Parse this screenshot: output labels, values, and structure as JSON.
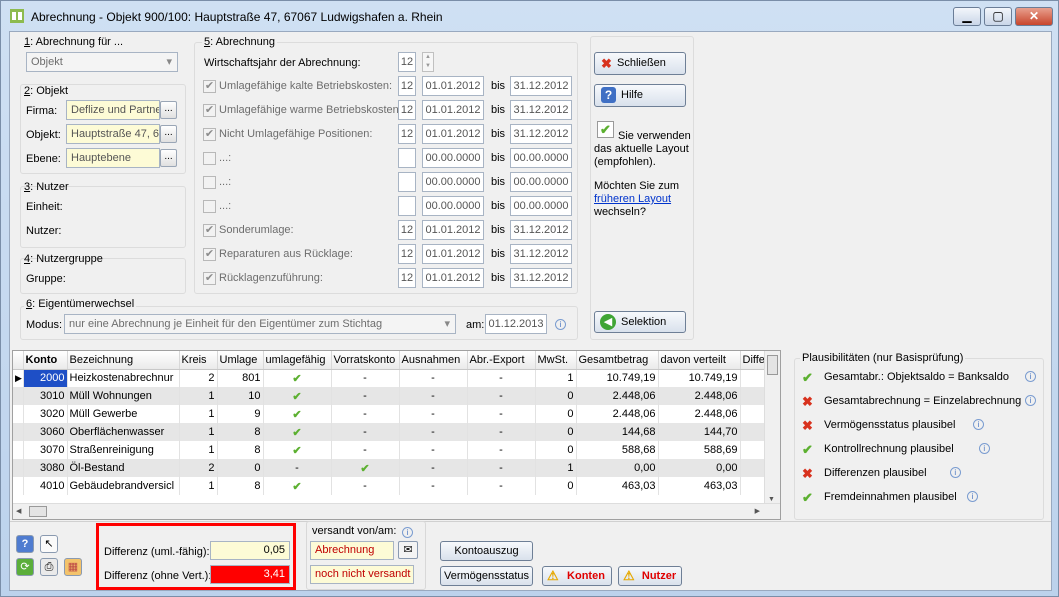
{
  "window": {
    "title": "Abrechnung - Objekt 900/100:  Hauptstraße 47, 67067 Ludwigshafen a. Rhein",
    "min": "▁",
    "max": "▢",
    "close": "✕"
  },
  "abr_fuer": {
    "label_num": "1",
    "label": ": Abrechnung für ...",
    "value": "Objekt"
  },
  "objekt": {
    "label_num": "2",
    "label": ": Objekt",
    "firma_label": "Firma:",
    "firma": "Deflize und Partne",
    "objekt_label": "Objekt:",
    "objekt": "Hauptstraße 47, 6",
    "ebene_label": "Ebene:",
    "ebene": "Hauptebene",
    "dots": "..."
  },
  "nutzer": {
    "label_num": "3",
    "label": ": Nutzer",
    "einheit": "Einheit:",
    "nutzer": "Nutzer:"
  },
  "gruppe": {
    "label_num": "4",
    "label": ": Nutzergruppe",
    "gruppe": "Gruppe:"
  },
  "abrechnung": {
    "label_num": "5",
    "label": ": Abrechnung",
    "wj_label": "Wirtschaftsjahr der Abrechnung:",
    "wj": "12",
    "bis": "bis",
    "rows": [
      {
        "label": "Umlagefähige kalte Betriebskosten:",
        "checked": true,
        "month": "12",
        "from": "01.01.2012",
        "to": "31.12.2012"
      },
      {
        "label": "Umlagefähige warme Betriebskosten:",
        "checked": true,
        "month": "12",
        "from": "01.01.2012",
        "to": "31.12.2012"
      },
      {
        "label": "Nicht Umlagefähige Positionen:",
        "checked": true,
        "month": "12",
        "from": "01.01.2012",
        "to": "31.12.2012"
      },
      {
        "label": "...:",
        "checked": false,
        "month": "",
        "from": "00.00.0000",
        "to": "00.00.0000"
      },
      {
        "label": "...:",
        "checked": false,
        "month": "",
        "from": "00.00.0000",
        "to": "00.00.0000"
      },
      {
        "label": "...:",
        "checked": false,
        "month": "",
        "from": "00.00.0000",
        "to": "00.00.0000"
      },
      {
        "label": "Sonderumlage:",
        "checked": true,
        "month": "12",
        "from": "01.01.2012",
        "to": "31.12.2012"
      },
      {
        "label": "Reparaturen aus Rücklage:",
        "checked": true,
        "month": "12",
        "from": "01.01.2012",
        "to": "31.12.2012"
      },
      {
        "label": "Rücklagenzuführung:",
        "checked": true,
        "month": "12",
        "from": "01.01.2012",
        "to": "31.12.2012"
      }
    ]
  },
  "eigentuemer": {
    "label_num": "6",
    "label": ": Eigentümerwechsel",
    "modus_label": "Modus:",
    "modus": "nur eine Abrechnung je Einheit für den Eigentümer zum Stichtag",
    "am_label": "am:",
    "am": "01.12.2013"
  },
  "right": {
    "close": "Schließen",
    "help": "Hilfe",
    "layout_text": "Sie verwenden das aktuelle Layout (empfohlen).",
    "switch_q": "Möchten Sie zum",
    "switch_link": "früheren Layout",
    "switch_tail": "wechseln?",
    "selektion": "Selektion"
  },
  "grid": {
    "columns": [
      "Konto",
      "Bezeichnung",
      "Kreis",
      "Umlage",
      "umlagefähig",
      "Vorratskonto",
      "Ausnahmen",
      "Abr.-Export",
      "MwSt.",
      "Gesamtbetrag",
      "davon verteilt",
      "Differe"
    ],
    "rows": [
      {
        "konto": "2000",
        "bez": "Heizkostenabrechnur",
        "kreis": "2",
        "umlage": "801",
        "uml": "check",
        "vorrat": "-",
        "ausn": "-",
        "export": "-",
        "mwst": "1",
        "gesamt": "10.749,19",
        "verteilt": "10.749,19"
      },
      {
        "konto": "3010",
        "bez": "Müll Wohnungen",
        "kreis": "1",
        "umlage": "10",
        "uml": "check",
        "vorrat": "-",
        "ausn": "-",
        "export": "-",
        "mwst": "0",
        "gesamt": "2.448,06",
        "verteilt": "2.448,06"
      },
      {
        "konto": "3020",
        "bez": "Müll Gewerbe",
        "kreis": "1",
        "umlage": "9",
        "uml": "check",
        "vorrat": "-",
        "ausn": "-",
        "export": "-",
        "mwst": "0",
        "gesamt": "2.448,06",
        "verteilt": "2.448,06"
      },
      {
        "konto": "3060",
        "bez": "Oberflächenwasser",
        "kreis": "1",
        "umlage": "8",
        "uml": "check",
        "vorrat": "-",
        "ausn": "-",
        "export": "-",
        "mwst": "0",
        "gesamt": "144,68",
        "verteilt": "144,70"
      },
      {
        "konto": "3070",
        "bez": "Straßenreinigung",
        "kreis": "1",
        "umlage": "8",
        "uml": "check",
        "vorrat": "-",
        "ausn": "-",
        "export": "-",
        "mwst": "0",
        "gesamt": "588,68",
        "verteilt": "588,69"
      },
      {
        "konto": "3080",
        "bez": "Öl-Bestand",
        "kreis": "2",
        "umlage": "0",
        "uml": "-",
        "vorrat": "check",
        "ausn": "-",
        "export": "-",
        "mwst": "1",
        "gesamt": "0,00",
        "verteilt": "0,00"
      },
      {
        "konto": "4010",
        "bez": "Gebäudebrandversicl",
        "kreis": "1",
        "umlage": "8",
        "uml": "check",
        "vorrat": "-",
        "ausn": "-",
        "export": "-",
        "mwst": "0",
        "gesamt": "463,03",
        "verteilt": "463,03"
      }
    ]
  },
  "plaus": {
    "title": "Plausibilitäten (nur Basisprüfung)",
    "items": [
      {
        "text": "Gesamtabr.: Objektsaldo = Banksaldo",
        "status": "ok"
      },
      {
        "text": "Gesamtabrechnung = Einzelabrechnung",
        "status": "bad"
      },
      {
        "text": "Vermögensstatus plausibel",
        "status": "bad"
      },
      {
        "text": "Kontrollrechnung plausibel",
        "status": "ok"
      },
      {
        "text": "Differenzen plausibel",
        "status": "bad"
      },
      {
        "text": "Fremdeinnahmen plausibel",
        "status": "ok"
      }
    ]
  },
  "bottom": {
    "diff1_label": "Differenz (uml.-fähig):",
    "diff1": "0,05",
    "diff2_label": "Differenz (ohne Vert.):",
    "diff2": "3,41",
    "versandt_label": "versandt von/am:",
    "versandt_von": "Abrechnung",
    "versandt_am": "noch nicht versandt",
    "kontoauszug": "Kontoauszug",
    "vermoegen": "Vermögensstatus",
    "konten": "Konten",
    "nutzer": "Nutzer"
  },
  "colors": {
    "diff_highlight": "#ff0000",
    "error_red": "#e00000",
    "ok_green": "#5cb030"
  }
}
